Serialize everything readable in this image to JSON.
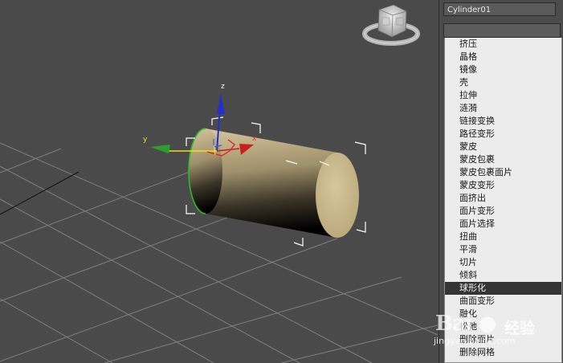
{
  "viewport": {
    "axis_labels": {
      "x": "x",
      "y": "y",
      "z": "z"
    }
  },
  "panel": {
    "object_name": "Cylinder01",
    "modifier_list": [
      "挤压",
      "晶格",
      "镜像",
      "壳",
      "拉伸",
      "涟漪",
      "链接变换",
      "路径变形",
      "蒙皮",
      "蒙皮包裹",
      "蒙皮包裹面片",
      "蒙皮变形",
      "面挤出",
      "面片变形",
      "面片选择",
      "扭曲",
      "平滑",
      "切片",
      "倾斜",
      "球形化",
      "曲面变形",
      "融化",
      "松弛",
      "删除面片",
      "删除网格"
    ],
    "selected_index": 19
  },
  "watermark": {
    "logo": "Bai 经验",
    "url": "jingyan.baidu.com"
  },
  "colors": {
    "viewport_bg": "#4a4a4a",
    "grid_line": "#7f7f7f",
    "cylinder_body": "#c7b68a",
    "x_axis": "#c82020",
    "y_axis": "#2aa02a",
    "z_axis": "#2030d0",
    "gizmo_yellow": "#f0e020"
  }
}
